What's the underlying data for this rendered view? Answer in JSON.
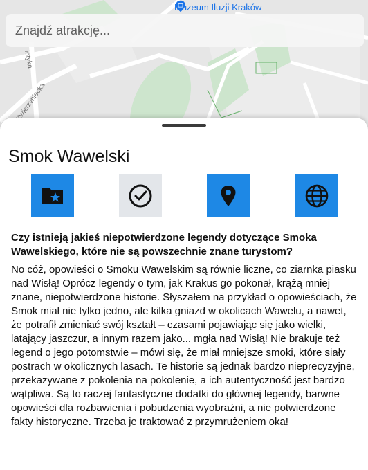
{
  "map": {
    "poi_label": "Muzeum Iluzji Kraków",
    "poi_icon": "museum-pin-icon",
    "road_labels": [
      "łotyka",
      "Zwierzyniecka"
    ]
  },
  "search": {
    "placeholder": "Znajdź atrakcję..."
  },
  "sheet": {
    "title": "Smok Wawelski",
    "actions": [
      {
        "name": "save-to-folder-button",
        "icon": "folder-star-icon",
        "style": "blue"
      },
      {
        "name": "mark-visited-button",
        "icon": "check-circle-icon",
        "style": "grey"
      },
      {
        "name": "show-on-map-button",
        "icon": "location-pin-icon",
        "style": "blue"
      },
      {
        "name": "website-button",
        "icon": "globe-icon",
        "style": "blue"
      }
    ],
    "question": "Czy istnieją jakieś niepotwierdzone legendy dotyczące Smoka Wawelskiego, które nie są powszechnie znane turystom?",
    "answer": "No cóż, opowieści o Smoku Wawelskim są równie liczne, co ziarnka piasku nad Wisłą! Oprócz legendy o tym, jak Krakus go pokonał, krążą mniej znane, niepotwierdzone historie. Słyszałem na przykład o opowieściach, że Smok miał nie tylko jedno, ale kilka gniazd w okolicach Wawelu, a nawet, że potrafił zmieniać swój kształt – czasami pojawiając się jako wielki, latający jaszczur, a innym razem jako... mgła nad Wisłą! Nie brakuje też legend o jego potomstwie – mówi się, że miał mniejsze smoki, które siały postrach w okolicznych lasach. Te historie są jednak bardzo nieprecyzyjne, przekazywane z pokolenia na pokolenie, a ich autentyczność jest bardzo wątpliwa. Są to raczej fantastyczne dodatki do głównej legendy, barwne opowieści dla rozbawienia i pobudzenia wyobraźni, a nie potwierdzone fakty historyczne. Trzeba je traktować z przymrużeniem oka!"
  },
  "colors": {
    "accent": "#1e88e5",
    "map_bg": "#e8e8e8",
    "park": "#cfe6cf",
    "poi": "#1a73e8"
  }
}
